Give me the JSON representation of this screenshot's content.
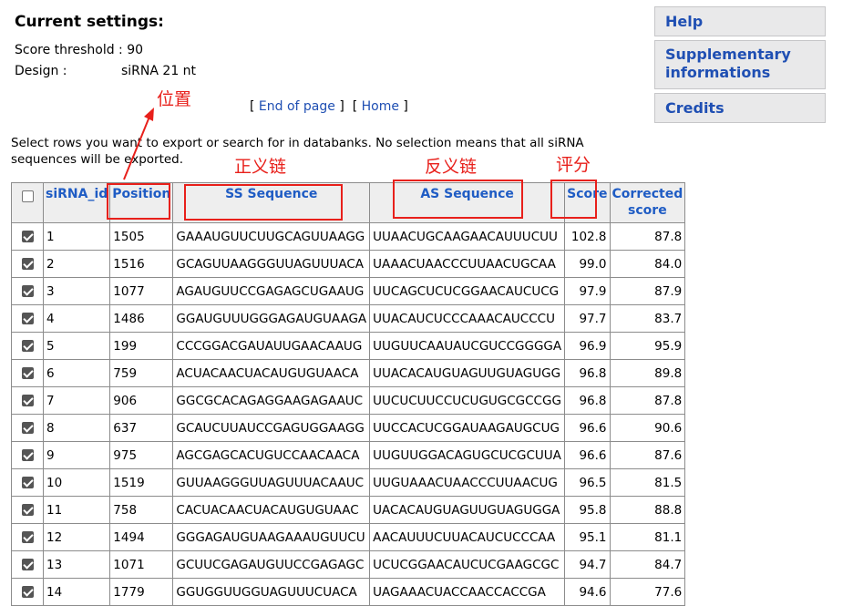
{
  "settings": {
    "title": "Current settings:",
    "score_label": "Score threshold :",
    "score_value": "90",
    "design_label": "Design :",
    "design_value": "siRNA 21 nt"
  },
  "nav": {
    "end_of_page": "End of page",
    "home": "Home"
  },
  "intro": "Select rows you want to export or search for in databanks. No selection means that all siRNA sequences will be exported.",
  "sidebar": {
    "help": "Help",
    "supplementary": "Supplementary informations",
    "credits": "Credits"
  },
  "table": {
    "headers": {
      "id": "siRNA_id",
      "position": "Position",
      "ss": "SS Sequence",
      "as": "AS Sequence",
      "score": "Score",
      "corrected": "Corrected score"
    },
    "rows": [
      {
        "id": "1",
        "position": "1505",
        "ss": "GAAAUGUUCUUGCAGUUAAGG",
        "as": "UUAACUGCAAGAACAUUUCUU",
        "score": "102.8",
        "corrected": "87.8"
      },
      {
        "id": "2",
        "position": "1516",
        "ss": "GCAGUUAAGGGUUAGUUUACA",
        "as": "UAAACUAACCCUUAACUGCAA",
        "score": "99.0",
        "corrected": "84.0"
      },
      {
        "id": "3",
        "position": "1077",
        "ss": "AGAUGUUCCGAGAGCUGAAUG",
        "as": "UUCAGCUCUCGGAACAUCUCG",
        "score": "97.9",
        "corrected": "87.9"
      },
      {
        "id": "4",
        "position": "1486",
        "ss": "GGAUGUUUGGGAGAUGUAAGA",
        "as": "UUACAUCUCCCAAACAUCCCU",
        "score": "97.7",
        "corrected": "83.7"
      },
      {
        "id": "5",
        "position": "199",
        "ss": "CCCGGACGAUAUUGAACAAUG",
        "as": "UUGUUCAAUAUCGUCCGGGGA",
        "score": "96.9",
        "corrected": "95.9"
      },
      {
        "id": "6",
        "position": "759",
        "ss": "ACUACAACUACAUGUGUAACA",
        "as": "UUACACAUGUAGUUGUAGUGG",
        "score": "96.8",
        "corrected": "89.8"
      },
      {
        "id": "7",
        "position": "906",
        "ss": "GGCGCACAGAGGAAGAGAAUC",
        "as": "UUCUCUUCCUCUGUGCGCCGG",
        "score": "96.8",
        "corrected": "87.8"
      },
      {
        "id": "8",
        "position": "637",
        "ss": "GCAUCUUAUCCGAGUGGAAGG",
        "as": "UUCCACUCGGAUAAGAUGCUG",
        "score": "96.6",
        "corrected": "90.6"
      },
      {
        "id": "9",
        "position": "975",
        "ss": "AGCGAGCACUGUCCAACAACA",
        "as": "UUGUUGGACAGUGCUCGCUUA",
        "score": "96.6",
        "corrected": "87.6"
      },
      {
        "id": "10",
        "position": "1519",
        "ss": "GUUAAGGGUUAGUUUACAAUC",
        "as": "UUGUAAACUAACCCUUAACUG",
        "score": "96.5",
        "corrected": "81.5"
      },
      {
        "id": "11",
        "position": "758",
        "ss": "CACUACAACUACAUGUGUAAC",
        "as": "UACACAUGUAGUUGUAGUGGA",
        "score": "95.8",
        "corrected": "88.8"
      },
      {
        "id": "12",
        "position": "1494",
        "ss": "GGGAGAUGUAAGAAAUGUUCU",
        "as": "AACAUUUCUUACAUCUCCCAA",
        "score": "95.1",
        "corrected": "81.1"
      },
      {
        "id": "13",
        "position": "1071",
        "ss": "GCUUCGAGAUGUUCCGAGAGC",
        "as": "UCUCGGAACAUCUCGAAGCGC",
        "score": "94.7",
        "corrected": "84.7"
      },
      {
        "id": "14",
        "position": "1779",
        "ss": "GGUGGUUGGUAGUUUCUACA",
        "as": "UAGAAACUACCAACCACCGA",
        "score": "94.6",
        "corrected": "77.6"
      }
    ]
  },
  "annotations": {
    "position": "位置",
    "ss": "正义链",
    "as": "反义链",
    "score": "评分",
    "color": "#e8201b"
  }
}
